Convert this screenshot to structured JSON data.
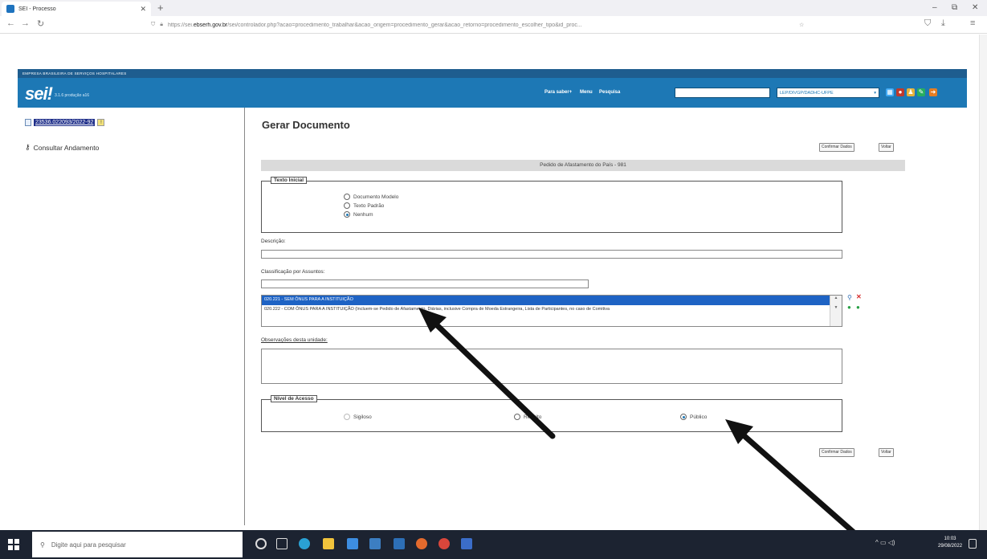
{
  "browser": {
    "tab_title": "SEI - Processo",
    "new_tab": "+",
    "url_prefix": "https://sei.",
    "url_domain": "ebserh.gov.br",
    "url_rest": "/sei/controlador.php?acao=procedimento_trabalhar&acao_origem=procedimento_gerar&acao_retorno=procedimento_escolher_tipo&id_proc...",
    "minimize": "–",
    "maximize": "⧉",
    "close": "✕"
  },
  "header": {
    "org_name": "EMPRESA BRASILEIRA DE SERVIÇOS HOSPITALARES",
    "logo": "sei!",
    "version": "3.1.6 produção a16",
    "link_para_saber": "Para saber+",
    "link_menu": "Menu",
    "link_pesquisa": "Pesquisa",
    "unit_selected": "LEP/DIVGP/DADHC-UFPE"
  },
  "left_panel": {
    "process_number": "23536.022093/2022-92",
    "consultar_andamento": "Consultar Andamento"
  },
  "main": {
    "title": "Gerar Documento",
    "btn_confirm": "Confirmar Dados",
    "btn_back": "Voltar",
    "doc_type": "Pedido de Afastamento do País - 981",
    "texto_inicial": {
      "legend": "Texto Inicial",
      "options": [
        "Documento Modelo",
        "Texto Padrão",
        "Nenhum"
      ],
      "selected": "Nenhum"
    },
    "descricao_label": "Descrição:",
    "classificacao_label": "Classificação por Assuntos:",
    "assuntos": [
      "020.221 - SEM ÔNUS PARA A INSTITUIÇÃO",
      "020.222 - COM ÔNUS PARA A INSTITUIÇÃO (Incluem-se Pedido de Afastamento, Diárias, inclusive Compra de Moeda Estrangeira, Lista de Participantes, no caso de Comitiva"
    ],
    "observacoes_label": "Observações desta unidade:",
    "nivel_acesso": {
      "legend": "Nível de Acesso",
      "options": [
        "Sigiloso",
        "Restrito",
        "Público"
      ],
      "selected": "Público"
    }
  },
  "taskbar": {
    "search_placeholder": "Digite aqui para pesquisar",
    "time": "10:03",
    "date": "29/08/2022"
  }
}
